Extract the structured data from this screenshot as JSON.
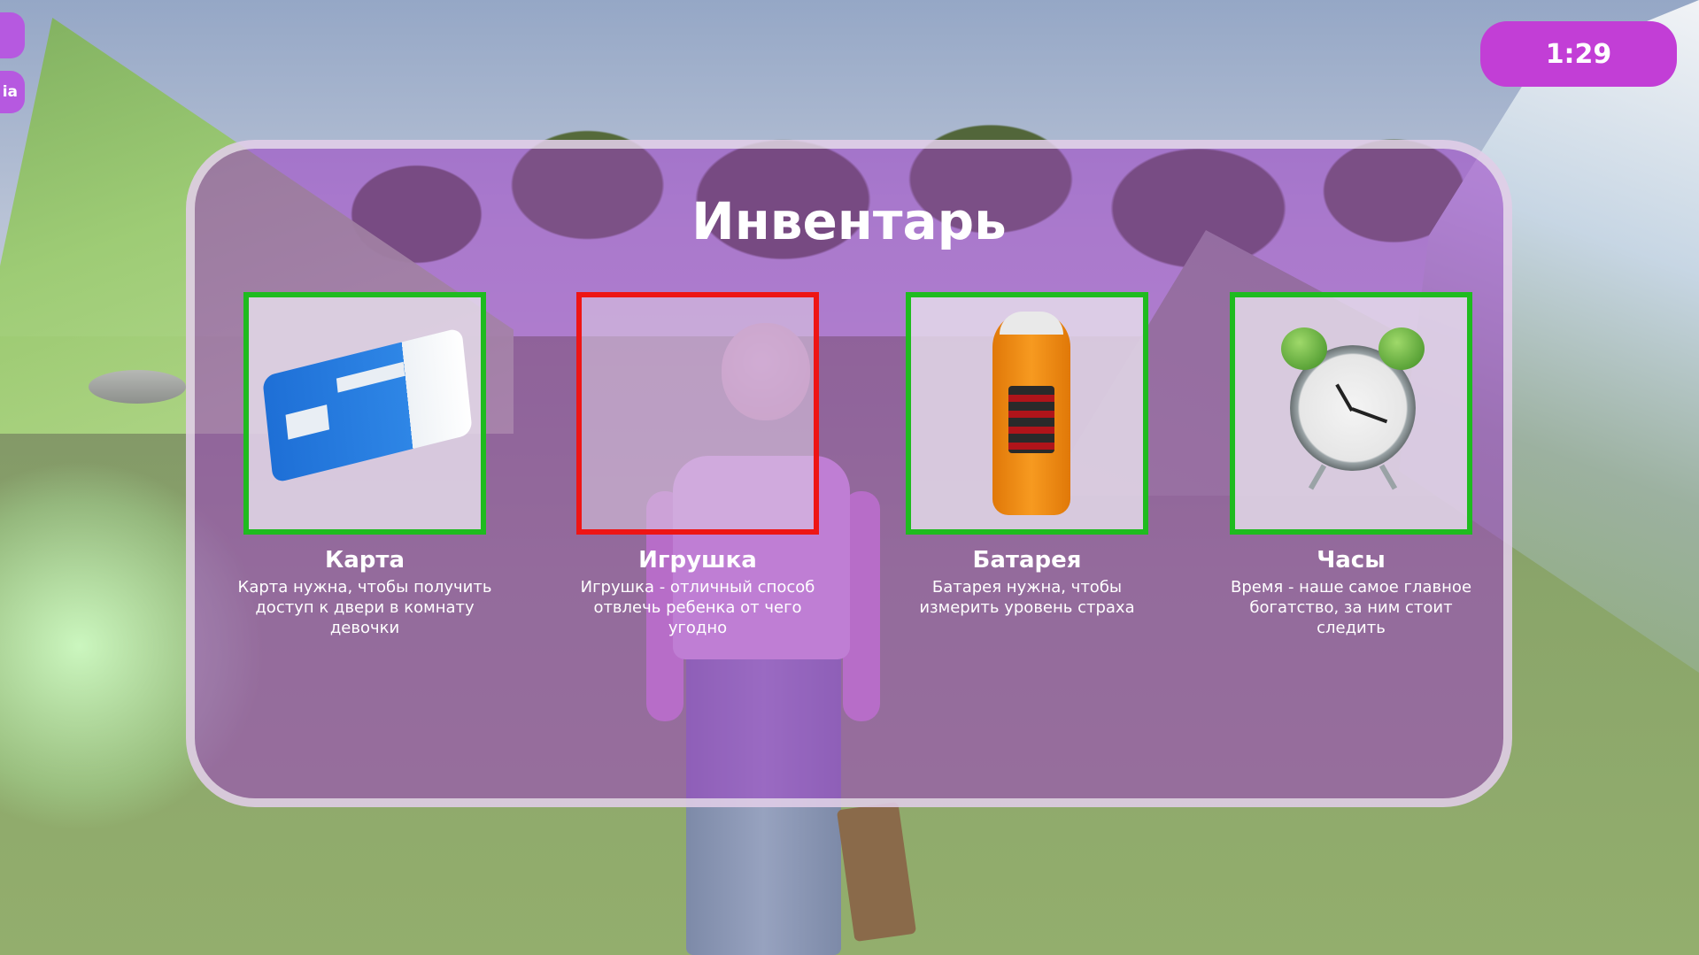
{
  "hud": {
    "timer": "1:29",
    "side_buttons": [
      {
        "label": ""
      },
      {
        "label": "ia"
      }
    ]
  },
  "inventory": {
    "title": "Инвентарь",
    "items": [
      {
        "name": "Карта",
        "description": "Карта нужна, чтобы получить доступ к двери в комнату девочки",
        "icon": "card-icon",
        "collected": true,
        "border_color": "#1fbb1f"
      },
      {
        "name": "Игрушка",
        "description": "Игрушка - отличный способ отвлечь ребенка от чего угодно",
        "icon": "",
        "collected": false,
        "border_color": "#ee1515"
      },
      {
        "name": "Батарея",
        "description": "Батарея нужна, чтобы измерить уровень страха",
        "icon": "battery-icon",
        "collected": true,
        "border_color": "#1fbb1f"
      },
      {
        "name": "Часы",
        "description": "Время - наше самое главное богатство, за ним стоит следить",
        "icon": "alarm-clock-icon",
        "collected": true,
        "border_color": "#1fbb1f"
      }
    ]
  },
  "colors": {
    "panel": "#9c3cc4",
    "timer": "#c23ed6",
    "collected_border": "#1fbb1f",
    "missing_border": "#ee1515"
  }
}
